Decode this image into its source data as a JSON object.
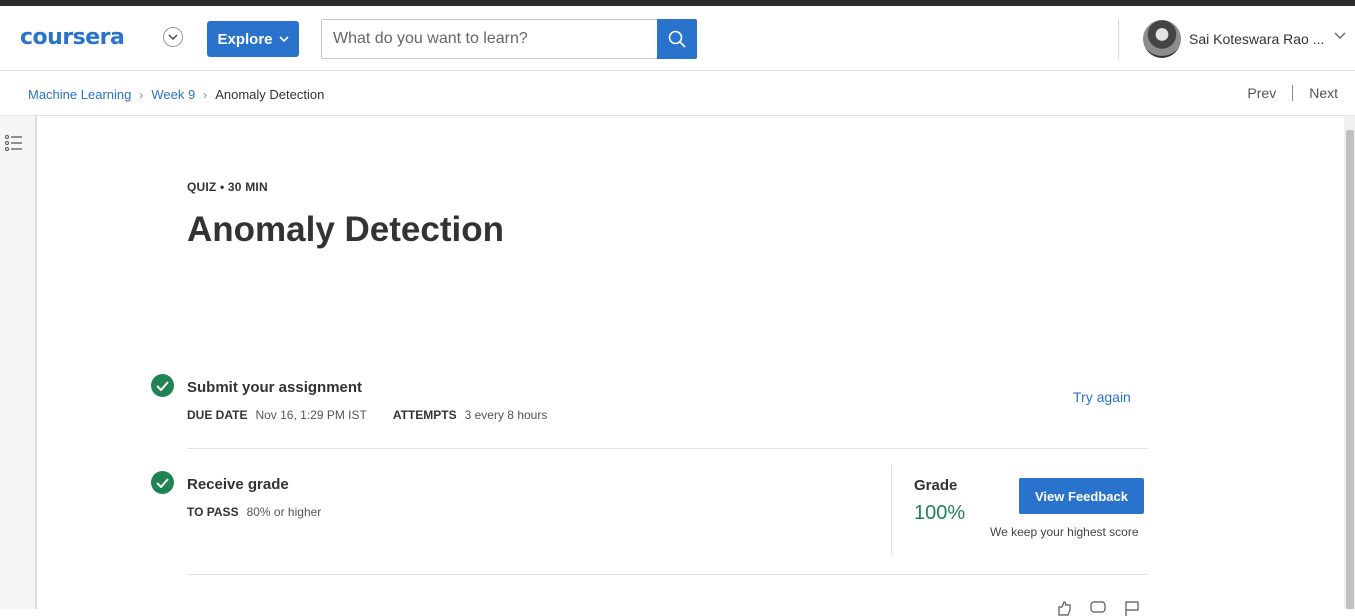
{
  "header": {
    "logo": "coursera",
    "explore_label": "Explore",
    "search_placeholder": "What do you want to learn?",
    "username": "Sai Koteswara Rao ...",
    "accent_color": "#2a73cc"
  },
  "breadcrumb": {
    "items": [
      "Machine Learning",
      "Week 9"
    ],
    "current": "Anomaly Detection",
    "prev_label": "Prev",
    "next_label": "Next"
  },
  "quiz": {
    "eyebrow": "QUIZ • 30 MIN",
    "title": "Anomaly Detection"
  },
  "assignment": {
    "title": "Submit your assignment",
    "due_key": "DUE DATE",
    "due_value": "Nov 16, 1:29 PM IST",
    "attempts_key": "ATTEMPTS",
    "attempts_value": "3 every 8 hours",
    "action_label": "Try again"
  },
  "grade": {
    "title": "Receive grade",
    "pass_key": "TO PASS",
    "pass_value": "80% or higher",
    "grade_label": "Grade",
    "grade_value": "100%",
    "feedback_label": "View Feedback",
    "note": "We keep your highest score",
    "success_color": "#1f8354"
  },
  "icons": [
    "chevron-down-icon",
    "search-icon",
    "list-outline-icon",
    "check-circle-icon",
    "thumbs-up-icon",
    "chat-icon",
    "flag-icon"
  ]
}
